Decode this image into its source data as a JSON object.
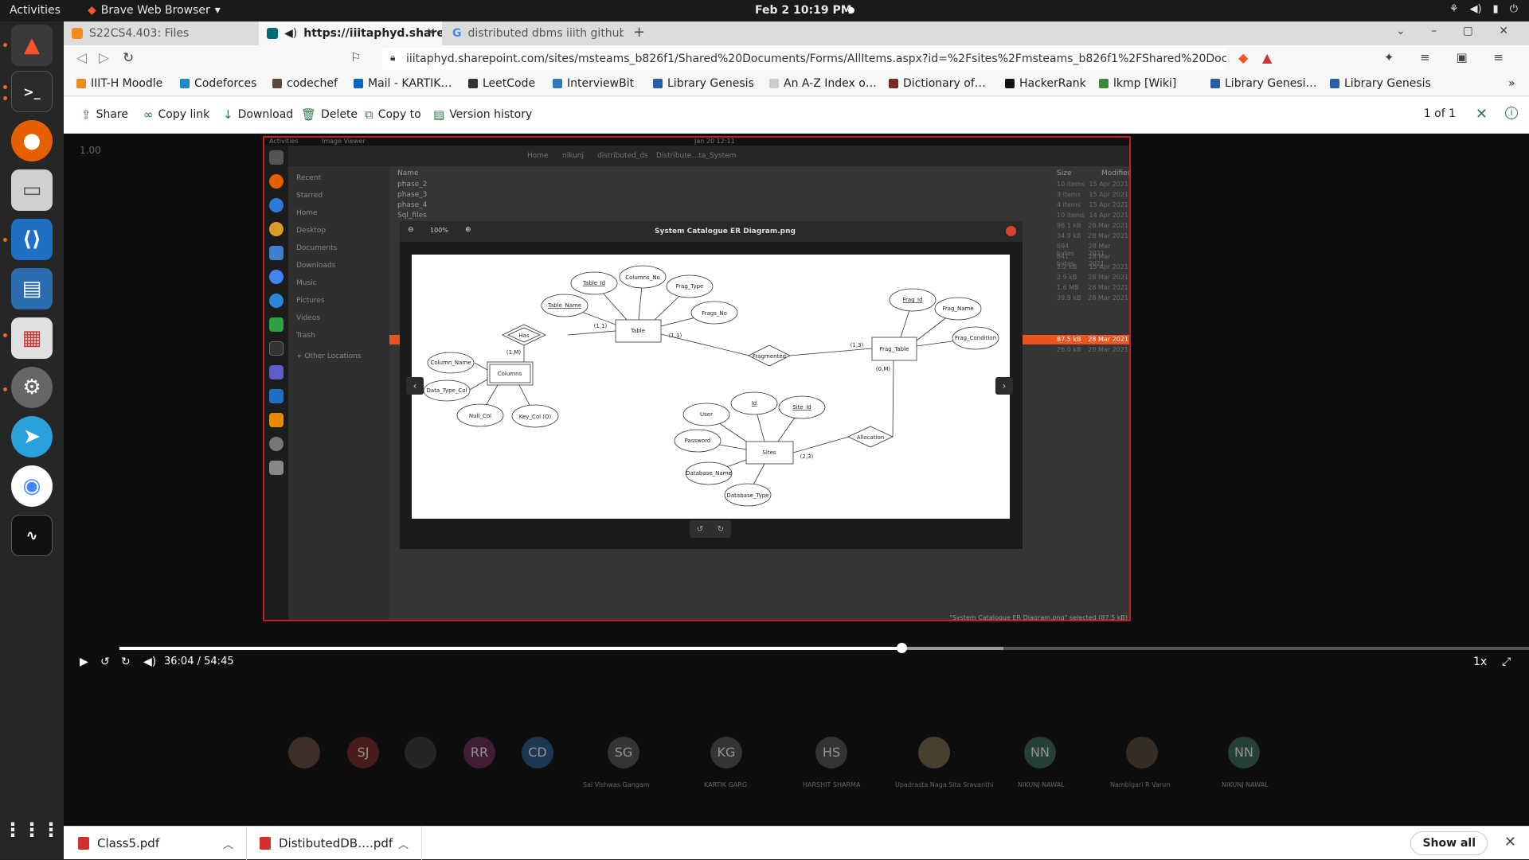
{
  "topbar": {
    "activities": "Activities",
    "app_name": "Brave Web Browser",
    "clock": "Feb 2  10:19 PM"
  },
  "tabs": [
    {
      "label": "S22CS4.403: Files"
    },
    {
      "label": "https://iiitaphyd.sharep"
    },
    {
      "label": "distributed dbms iiith github"
    }
  ],
  "address": {
    "url": "iiitaphyd.sharepoint.com/sites/msteams_b826f1/Shared%20Documents/Forms/AllItems.aspx?id=%2Fsites%2Fmsteams_b826f1%2FShared%20Docume…"
  },
  "bookmarks": [
    "IIIT-H Moodle",
    "Codeforces",
    "codechef",
    "Mail - KARTIK…",
    "LeetCode",
    "InterviewBit",
    "Library Genesis",
    "An A-Z Index o…",
    "Dictionary of…",
    "HackerRank",
    "lkmp [Wiki]",
    "Library Genesi…",
    "Library Genesis"
  ],
  "commands": {
    "share": "Share",
    "copy_link": "Copy link",
    "download": "Download",
    "delete": "Delete",
    "copy_to": "Copy to",
    "version_history": "Version history",
    "pager": "1 of 1"
  },
  "video": {
    "zoom_label": "1.00",
    "progress": 0.555,
    "time_current": "36:04",
    "time_sep": "/",
    "time_total": "54:45",
    "speed": "1x"
  },
  "shared_screen": {
    "topbar_activities": "Activities",
    "topbar_app": "Image Viewer",
    "topbar_clock": "Jan 20  12:11",
    "path": [
      "Home",
      "nikunj",
      "distributed_ds",
      "Distribute…ta_System"
    ],
    "sidebar": [
      "Recent",
      "Starred",
      "Home",
      "Desktop",
      "Documents",
      "Downloads",
      "Music",
      "Pictures",
      "Videos",
      "Trash",
      "+ Other Locations"
    ],
    "col_name": "Name",
    "col_size": "Size",
    "col_modified": "Modified",
    "files": [
      "phase_2",
      "phase_3",
      "phase_4",
      "Sql_files"
    ],
    "sizes": [
      [
        "10 items",
        "15 Apr 2021"
      ],
      [
        "3 items",
        "15 Apr 2021"
      ],
      [
        "4 items",
        "15 Apr 2021"
      ],
      [
        "10 items",
        "14 Apr 2021"
      ],
      [
        "96.1 kB",
        "28 Mar 2021"
      ],
      [
        "34.9 kB",
        "28 Mar 2021"
      ],
      [
        "694 bytes",
        "28 Mar 2021"
      ],
      [
        "641 bytes",
        "28 Mar 2021"
      ],
      [
        "2.2 kB",
        "15 Apr 2021"
      ],
      [
        "2.9 kB",
        "28 Mar 2021"
      ],
      [
        "1.6 MB",
        "28 Mar 2021"
      ],
      [
        "39.9 kB",
        "28 Mar 2021"
      ],
      [
        "87.5 kB",
        "28 Mar 2021"
      ],
      [
        "26.0 kB",
        "28 Mar 2021"
      ]
    ],
    "status": "\"System Catalogue ER Diagram.png\" selected (87.5 kB)",
    "viewer_title": "System Catalogue ER Diagram.png",
    "viewer_zoom": "100%"
  },
  "er": {
    "entities": [
      "Table",
      "Columns",
      "Frag_Table",
      "Sites"
    ],
    "relations": [
      "Has",
      "Fragmented",
      "Allocation"
    ],
    "attributes": [
      "Table_Id",
      "Columns_No",
      "Frag_Type",
      "Table_Name",
      "Frags_No",
      "Column_Name",
      "Data_Type_Col",
      "Null_Col",
      "Key_Col (O)",
      "Frag_Id",
      "Frag_Name",
      "Frag_Condition",
      "User",
      "Id",
      "Site_Id",
      "Password",
      "Database_Name",
      "Database_Type"
    ],
    "cardinalities": [
      "(1,1)",
      "(1,M)",
      "(1,1)",
      "(1,3)",
      "(0,M)",
      "(2,3)"
    ]
  },
  "participants": [
    {
      "initials": "",
      "name": ""
    },
    {
      "initials": "SJ",
      "name": ""
    },
    {
      "initials": "",
      "name": ""
    },
    {
      "initials": "RR",
      "name": ""
    },
    {
      "initials": "CD",
      "name": ""
    },
    {
      "initials": "SG",
      "name": "Sai Vishwas Gangam"
    },
    {
      "initials": "KG",
      "name": "KARTIK GARG"
    },
    {
      "initials": "HS",
      "name": "HARSHIT SHARMA"
    },
    {
      "initials": "",
      "name": "Upadrasta Naga Sita Sravanthi"
    },
    {
      "initials": "NN",
      "name": "NIKUNJ NAWAL"
    },
    {
      "initials": "",
      "name": "Nambigari R Varun"
    },
    {
      "initials": "NN",
      "name": "NIKUNJ NAWAL"
    }
  ],
  "downloads": [
    {
      "name": "Class5.pdf"
    },
    {
      "name": "DistibutedDB….pdf"
    }
  ],
  "shelf": {
    "show_all": "Show all"
  }
}
